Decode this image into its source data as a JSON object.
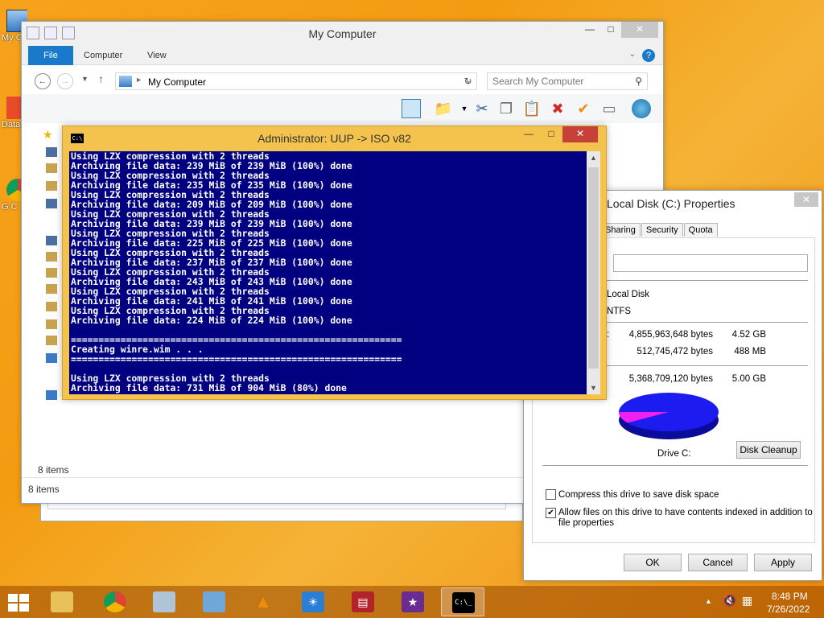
{
  "desktop": {
    "icons": [
      {
        "label": "My C"
      },
      {
        "label": "Data"
      },
      {
        "label": "G C"
      }
    ]
  },
  "explorer": {
    "title": "My Computer",
    "tabs": [
      {
        "label": "File"
      },
      {
        "label": "Computer"
      },
      {
        "label": "View"
      }
    ],
    "address": "My Computer",
    "search_placeholder": "Search My Computer",
    "status_items_pane": "8 items",
    "status_items_bar": "8 items"
  },
  "cmd": {
    "title": "Administrator:  UUP -> ISO v82",
    "lines": [
      "Using LZX compression with 2 threads",
      "Archiving file data: 239 MiB of 239 MiB (100%) done",
      "Using LZX compression with 2 threads",
      "Archiving file data: 235 MiB of 235 MiB (100%) done",
      "Using LZX compression with 2 threads",
      "Archiving file data: 209 MiB of 209 MiB (100%) done",
      "Using LZX compression with 2 threads",
      "Archiving file data: 239 MiB of 239 MiB (100%) done",
      "Using LZX compression with 2 threads",
      "Archiving file data: 225 MiB of 225 MiB (100%) done",
      "Using LZX compression with 2 threads",
      "Archiving file data: 237 MiB of 237 MiB (100%) done",
      "Using LZX compression with 2 threads",
      "Archiving file data: 243 MiB of 243 MiB (100%) done",
      "Using LZX compression with 2 threads",
      "Archiving file data: 241 MiB of 241 MiB (100%) done",
      "Using LZX compression with 2 threads",
      "Archiving file data: 224 MiB of 224 MiB (100%) done",
      "",
      "============================================================",
      "Creating winre.wim . . .",
      "============================================================",
      "",
      "Using LZX compression with 2 threads",
      "Archiving file data: 731 MiB of 904 MiB (80%) done"
    ]
  },
  "properties": {
    "title": "Local Disk (C:) Properties",
    "tabs": [
      {
        "label": "Sharing"
      },
      {
        "label": "Security"
      },
      {
        "label": "Quota"
      }
    ],
    "type_value": "Local Disk",
    "fs_value": "NTFS",
    "used_label": ":",
    "used_bytes": "4,855,963,648 bytes",
    "used_size": "4.52 GB",
    "free_bytes": "512,745,472 bytes",
    "free_size": "488 MB",
    "capacity_bytes": "5,368,709,120 bytes",
    "capacity_size": "5.00 GB",
    "drive_label": "Drive C:",
    "disk_cleanup": "Disk Cleanup",
    "compress_label": "Compress this drive to save disk space",
    "compress_checked": false,
    "index_label_1": "Allow files on this drive to have contents indexed in addition to",
    "index_label_2": "file properties",
    "index_checked": true,
    "ok": "OK",
    "cancel": "Cancel",
    "apply": "Apply",
    "used_fraction": 0.9045,
    "colors": {
      "used": "#1c1cf0",
      "free": "#f020f0"
    }
  },
  "taskbar": {
    "time": "8:48 PM",
    "date": "7/26/2022",
    "apps": [
      {
        "icon": "file-explorer-icon"
      },
      {
        "icon": "chrome-icon"
      },
      {
        "icon": "system-monitor-icon"
      },
      {
        "icon": "drive-icon"
      },
      {
        "icon": "vlc-icon"
      },
      {
        "icon": "brightness-icon"
      },
      {
        "icon": "news-icon"
      },
      {
        "icon": "trophy-icon"
      },
      {
        "icon": "command-prompt-icon"
      }
    ]
  }
}
